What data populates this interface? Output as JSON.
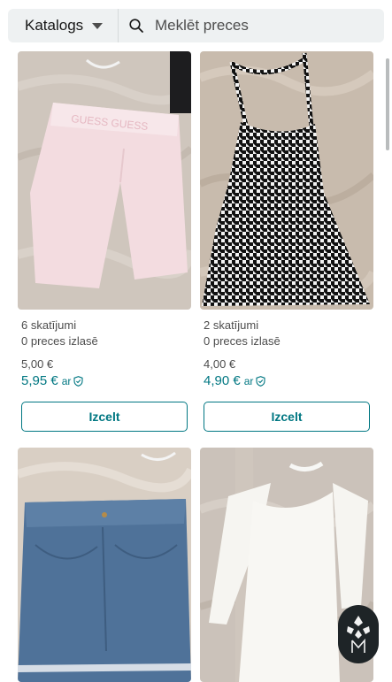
{
  "header": {
    "catalog_label": "Katalogs",
    "search_placeholder": "Meklēt preces"
  },
  "items": [
    {
      "views": "6 skatījumi",
      "favorites": "0 preces izlasē",
      "price": "5,00 €",
      "price_with_protection": "5,95 €",
      "protection_suffix": "ar",
      "bump_label": "Izcelt"
    },
    {
      "views": "2 skatījumi",
      "favorites": "0 preces izlasē",
      "price": "4,00 €",
      "price_with_protection": "4,90 €",
      "protection_suffix": "ar",
      "bump_label": "Izcelt"
    }
  ],
  "icons": {
    "search": "search-icon",
    "dropdown": "chevron-down-icon",
    "protection": "shield-check-icon",
    "assistant": "assistant-logo-icon"
  },
  "colors": {
    "accent": "#007782",
    "text": "#171717",
    "muted": "#4d4d4d",
    "search_bg": "#eef1f2"
  }
}
